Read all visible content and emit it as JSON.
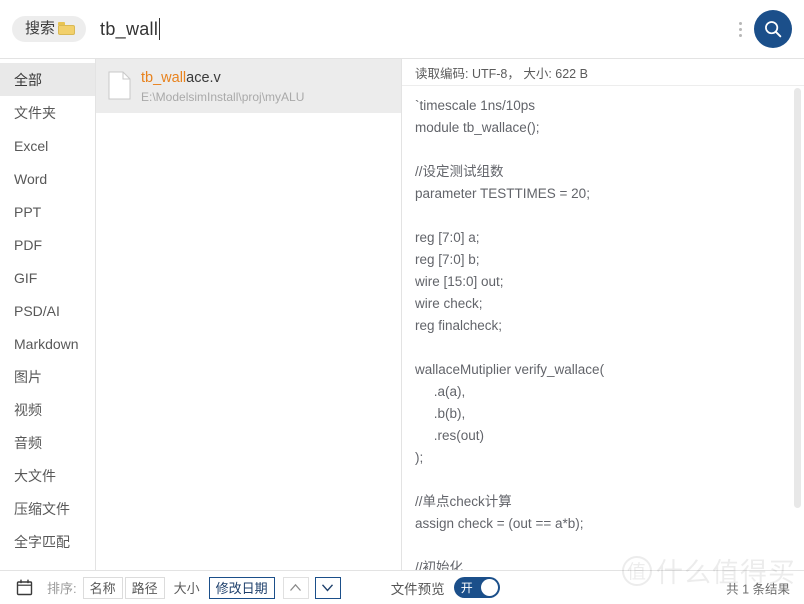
{
  "search": {
    "tag_label": "搜索",
    "tag_icon": "folder-icon",
    "query_value": "tb_wall",
    "placeholder": "",
    "menu_icon": "kebab-menu-icon",
    "submit_icon": "search-icon"
  },
  "sidebar": {
    "items": [
      {
        "label": "全部",
        "selected": true
      },
      {
        "label": "文件夹",
        "selected": false
      },
      {
        "label": "Excel",
        "selected": false
      },
      {
        "label": "Word",
        "selected": false
      },
      {
        "label": "PPT",
        "selected": false
      },
      {
        "label": "PDF",
        "selected": false
      },
      {
        "label": "GIF",
        "selected": false
      },
      {
        "label": "PSD/AI",
        "selected": false
      },
      {
        "label": "Markdown",
        "selected": false
      },
      {
        "label": "图片",
        "selected": false
      },
      {
        "label": "视频",
        "selected": false
      },
      {
        "label": "音频",
        "selected": false
      },
      {
        "label": "大文件",
        "selected": false
      },
      {
        "label": "压缩文件",
        "selected": false
      },
      {
        "label": "全字匹配",
        "selected": false
      }
    ]
  },
  "results": {
    "items": [
      {
        "icon": "document-icon",
        "name_match": "tb_wall",
        "name_rest": "ace.v",
        "path": "E:\\ModelsimInstall\\proj\\myALU",
        "selected": true
      }
    ]
  },
  "preview": {
    "header": "读取编码: UTF-8，  大小: 622 B",
    "lines": [
      "`timescale 1ns/10ps",
      "module tb_wallace();",
      "",
      "//设定测试组数",
      "parameter TESTTIMES = 20;",
      "",
      "reg [7:0] a;",
      "reg [7:0] b;",
      "wire [15:0] out;",
      "wire check;",
      "reg finalcheck;",
      "",
      "wallaceMutiplier verify_wallace(",
      "     .a(a),",
      "     .b(b),",
      "     .res(out)",
      ");",
      "",
      "//单点check计算",
      "assign check = (out == a*b);",
      "",
      "//初始化"
    ]
  },
  "bottombar": {
    "calendar_icon": "calendar-icon",
    "sort_label": "排序:",
    "sort_options": [
      {
        "label": "名称",
        "active": false,
        "boxed": true
      },
      {
        "label": "路径",
        "active": false,
        "boxed": true
      },
      {
        "label": "大小",
        "active": false,
        "boxed": false
      },
      {
        "label": "修改日期",
        "active": true,
        "boxed": true
      }
    ],
    "asc_icon": "chevron-up-icon",
    "desc_icon": "chevron-down-icon",
    "preview_toggle_label": "文件预览",
    "preview_toggle_state": "开",
    "result_count": "共 1 条结果"
  },
  "watermark": {
    "mark": "值",
    "text": "什么值得买"
  },
  "colors": {
    "accent": "#1b4f8a",
    "highlight": "#e8821d",
    "selected_bg": "#ececec",
    "muted_text": "#a9a9a9"
  }
}
